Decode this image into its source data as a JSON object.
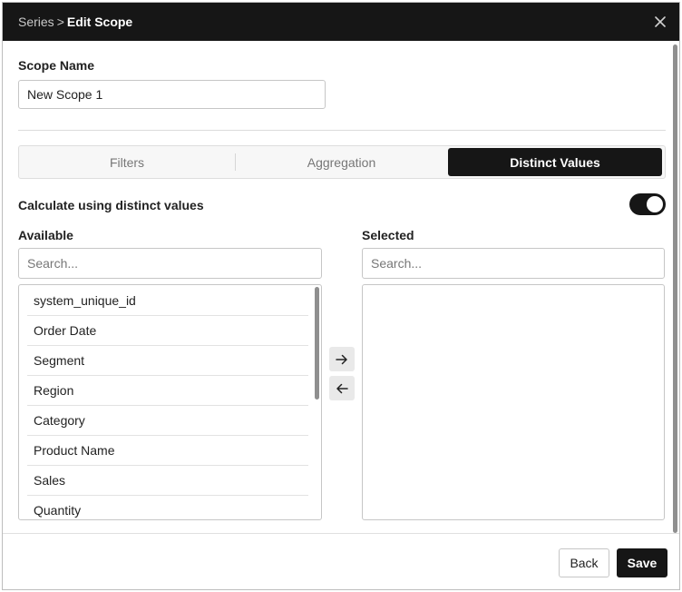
{
  "titlebar": {
    "breadcrumb_parent": "Series",
    "breadcrumb_separator": ">",
    "breadcrumb_current": "Edit Scope",
    "close_icon": "close-icon"
  },
  "scope_name": {
    "label": "Scope Name",
    "value": "New Scope 1"
  },
  "tabs": [
    {
      "label": "Filters",
      "active": false
    },
    {
      "label": "Aggregation",
      "active": false
    },
    {
      "label": "Distinct Values",
      "active": true
    }
  ],
  "distinct": {
    "toggle_label": "Calculate using distinct values",
    "toggle_on": true
  },
  "available": {
    "label": "Available",
    "search_placeholder": "Search...",
    "items": [
      "system_unique_id",
      "Order Date",
      "Segment",
      "Region",
      "Category",
      "Product Name",
      "Sales",
      "Quantity"
    ]
  },
  "selected": {
    "label": "Selected",
    "search_placeholder": "Search...",
    "items": []
  },
  "transfer": {
    "add_icon": "arrow-right-icon",
    "remove_icon": "arrow-left-icon"
  },
  "footer": {
    "back_label": "Back",
    "save_label": "Save"
  },
  "colors": {
    "accent_dark": "#161616",
    "border": "#c6c6c6"
  }
}
